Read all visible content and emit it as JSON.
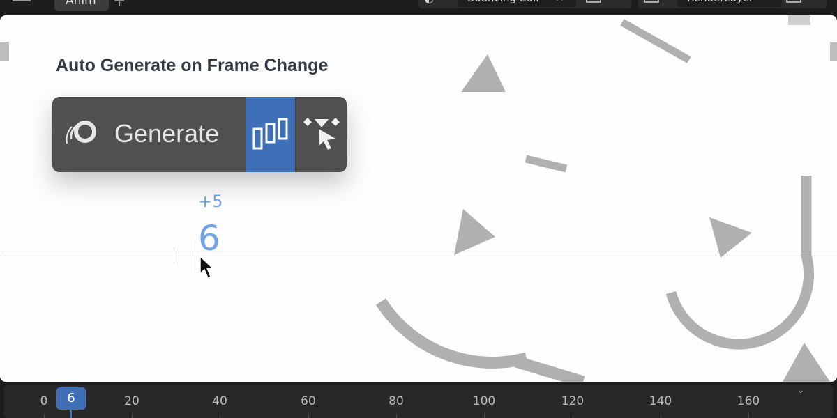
{
  "workspace": {
    "tab_label": "Anim",
    "add_tab_icon": "plus-icon",
    "menu_icon": "hamburger-icon"
  },
  "scene": {
    "name": "Bouncing Ball",
    "icon": "scene-icon"
  },
  "view_layer": {
    "name": "RenderLayer",
    "icon": "layers-icon"
  },
  "demo": {
    "title": "Auto Generate on Frame Change",
    "generate_label": "Generate",
    "generate_icon": "generate-icon",
    "mode_icon": "auto-generate-mode-icon",
    "pick_icon": "pick-selection-icon",
    "frame_delta": "+5",
    "current_frame": "6"
  },
  "timeline": {
    "current_frame": "6",
    "labels": [
      "0",
      "20",
      "40",
      "60",
      "80",
      "100",
      "120",
      "140",
      "160"
    ]
  },
  "colors": {
    "accent_blue": "#3f6fb6",
    "frame_text_blue": "#6fa3e4",
    "widget_gray": "#505050",
    "shape_gray": "#b0b0b0"
  }
}
